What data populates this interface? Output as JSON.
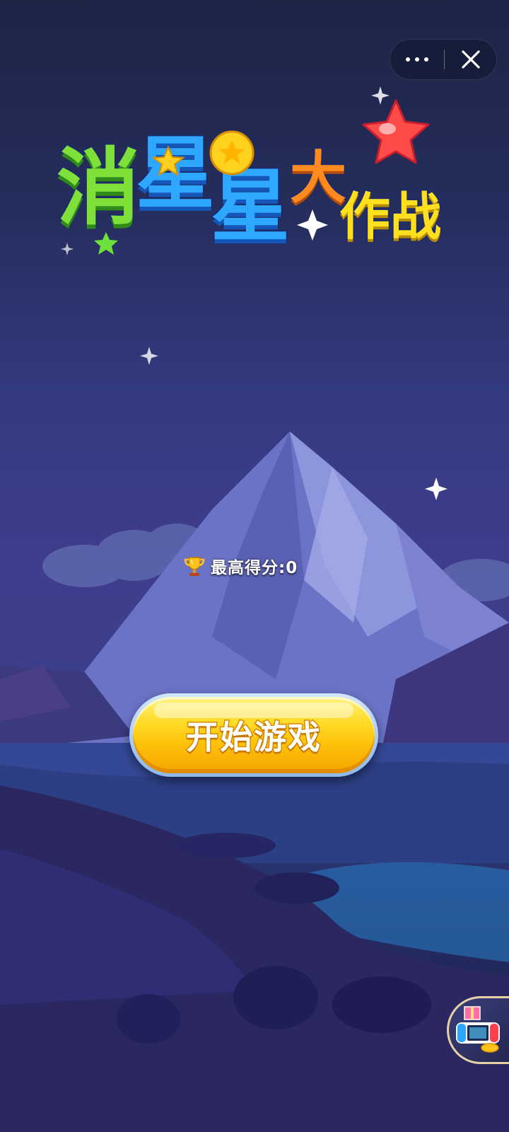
{
  "window": {
    "more_icon": "more-dots-icon",
    "close_icon": "close-x-icon"
  },
  "game": {
    "title_chars": [
      "消",
      "星",
      "星",
      "大",
      "作战"
    ],
    "high_score_label": "最高得分:0",
    "trophy_icon": "trophy-icon",
    "start_button_label": "开始游戏",
    "floating_ad_icon": "game-console-gift-icon"
  },
  "colors": {
    "title_green": "#7fe03a",
    "title_blue": "#2ea8ff",
    "title_orange": "#ff8a1f",
    "title_yellow": "#ffe01f",
    "button_yellow": "#ffc10a",
    "background_top": "#1d2446",
    "background_mid": "#3f3d8e"
  }
}
